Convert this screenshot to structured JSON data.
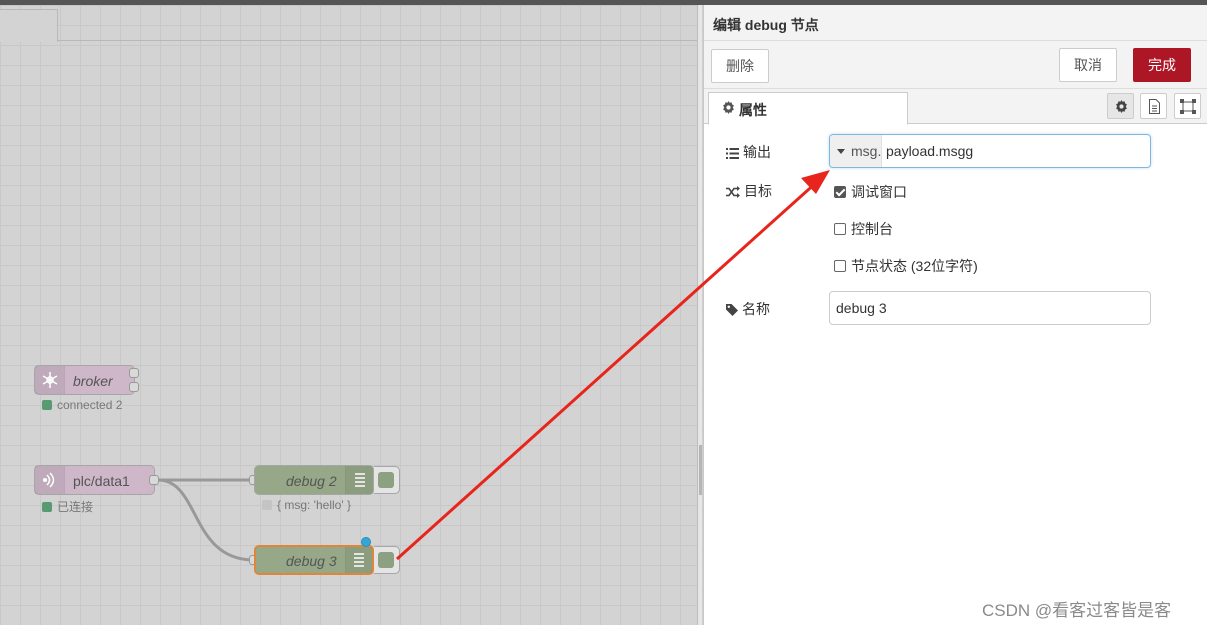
{
  "workspace": {
    "nodes": {
      "broker": {
        "label": "broker",
        "status": "connected 2",
        "status_color": "#5a9a73"
      },
      "plc": {
        "label": "plc/data1",
        "status": "已连接",
        "status_color": "#5a9a73"
      },
      "debug2": {
        "label": "debug 2",
        "status": "{ msg: 'hello' }",
        "status_color": "#c4c4c4"
      },
      "debug3": {
        "label": "debug 3"
      }
    }
  },
  "panel": {
    "title": "编辑 debug 节点",
    "delete_label": "删除",
    "cancel_label": "取消",
    "done_label": "完成",
    "tab_label": "属性",
    "output": {
      "label": "输出",
      "type": "msg.",
      "value": "payload.msgg"
    },
    "target": {
      "label": "目标",
      "options": [
        {
          "label": "调试窗口",
          "checked": true
        },
        {
          "label": "控制台",
          "checked": false
        },
        {
          "label": "节点状态 (32位字符)",
          "checked": false
        }
      ]
    },
    "name": {
      "label": "名称",
      "value": "debug 3"
    }
  },
  "watermark": "CSDN @看客过客皆是客",
  "colors": {
    "done_button": "#ad1625",
    "annotation_arrow": "#e8251c",
    "debug_node": "#97a888",
    "mqtt_node": "#cdb7c9",
    "selected_outline": "#e0863a"
  }
}
